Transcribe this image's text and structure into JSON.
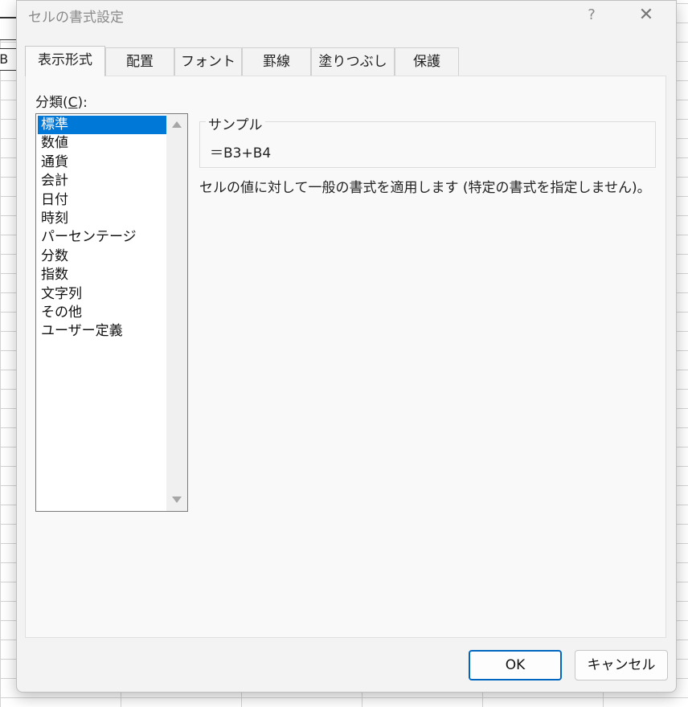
{
  "background": {
    "cell_fragments": [
      "",
      ")",
      "-B"
    ]
  },
  "dialog": {
    "title": "セルの書式設定",
    "help_label": "?",
    "close_label": "✕"
  },
  "tabs": [
    {
      "label": "表示形式",
      "active": true
    },
    {
      "label": "配置"
    },
    {
      "label": "フォント"
    },
    {
      "label": "罫線"
    },
    {
      "label": "塗りつぶし"
    },
    {
      "label": "保護"
    }
  ],
  "category": {
    "label_prefix": "分類(",
    "label_accel": "C",
    "label_suffix": "):",
    "items": [
      "標準",
      "数値",
      "通貨",
      "会計",
      "日付",
      "時刻",
      "パーセンテージ",
      "分数",
      "指数",
      "文字列",
      "その他",
      "ユーザー定義"
    ],
    "selected_index": 0
  },
  "sample": {
    "legend": "サンプル",
    "value": "＝B3+B4"
  },
  "description": "セルの値に対して一般の書式を適用します (特定の書式を指定しません)。",
  "buttons": {
    "ok": "OK",
    "cancel": "キャンセル"
  },
  "colors": {
    "selection": "#0078d7",
    "ok_border": "#0067c0"
  },
  "icons": {
    "scroll_up": "scroll-up-arrow-icon",
    "scroll_down": "scroll-down-arrow-icon",
    "close": "close-icon"
  }
}
